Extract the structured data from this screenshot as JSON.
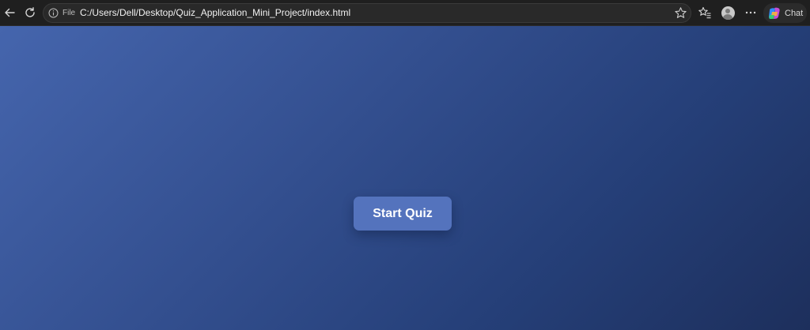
{
  "browser": {
    "address_bar": {
      "scheme_label": "File",
      "url": "C:/Users/Dell/Desktop/Quiz_Application_Mini_Project/index.html"
    },
    "chat_label": "Chat",
    "icons": {
      "back": "back-arrow-icon",
      "reload": "reload-icon",
      "info": "info-icon",
      "favorite": "star-icon",
      "favorites": "favorites-list-icon",
      "profile": "profile-avatar-icon",
      "more": "more-dots-icon",
      "copilot": "copilot-icon"
    }
  },
  "page": {
    "start_button_label": "Start Quiz"
  },
  "colors": {
    "background_start": "#4565ad",
    "background_end": "#1d2f5c",
    "button": "#5473bd"
  }
}
